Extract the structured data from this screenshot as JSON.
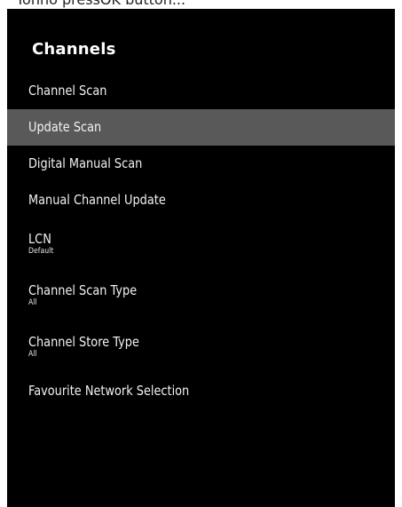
{
  "top_text": "Tonho pressOK button...",
  "panel": {
    "title": "Channels"
  },
  "menu": {
    "selected_index": 1,
    "items": [
      {
        "label": "Channel Scan"
      },
      {
        "label": "Update Scan"
      },
      {
        "label": "Digital Manual Scan"
      },
      {
        "label": "Manual Channel Update"
      },
      {
        "label": "LCN",
        "value": "Default"
      },
      {
        "label": "Channel Scan Type",
        "value": "All"
      },
      {
        "label": "Channel Store Type",
        "value": "All"
      },
      {
        "label": "Favourite Network Selection"
      }
    ]
  },
  "colors": {
    "panel_background": "#000000",
    "selected_highlight": "#595959",
    "text": "#f2f2f2"
  }
}
